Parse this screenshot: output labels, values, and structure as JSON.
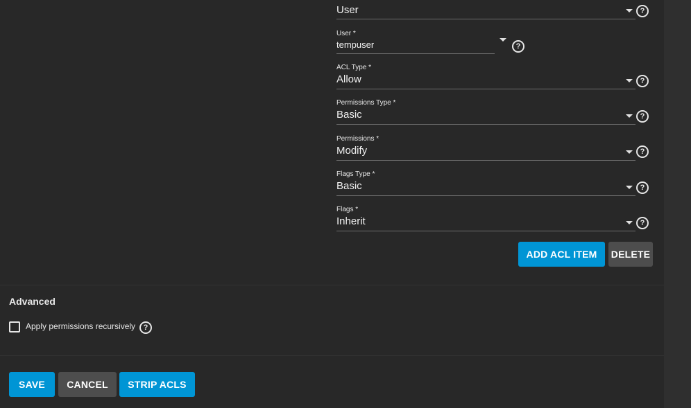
{
  "acl_entry": {
    "tag": {
      "value": "User"
    },
    "user": {
      "label": "User *",
      "value": "tempuser"
    },
    "acl_type": {
      "label": "ACL Type *",
      "value": "Allow"
    },
    "permissions_type": {
      "label": "Permissions Type *",
      "value": "Basic"
    },
    "permissions": {
      "label": "Permissions *",
      "value": "Modify"
    },
    "flags_type": {
      "label": "Flags Type *",
      "value": "Basic"
    },
    "flags": {
      "label": "Flags *",
      "value": "Inherit"
    },
    "add_button": "ADD ACL ITEM",
    "delete_button": "DELETE"
  },
  "advanced": {
    "title": "Advanced",
    "recursive_label": "Apply permissions recursively",
    "recursive_checked": false
  },
  "actions": {
    "save": "SAVE",
    "cancel": "CANCEL",
    "strip": "STRIP ACLS"
  },
  "icons": {
    "help": "help-circle-icon",
    "dropdown": "caret-down-icon"
  },
  "colors": {
    "background": "#282828",
    "primary": "#0095d5",
    "secondary": "#4d4d4d"
  }
}
